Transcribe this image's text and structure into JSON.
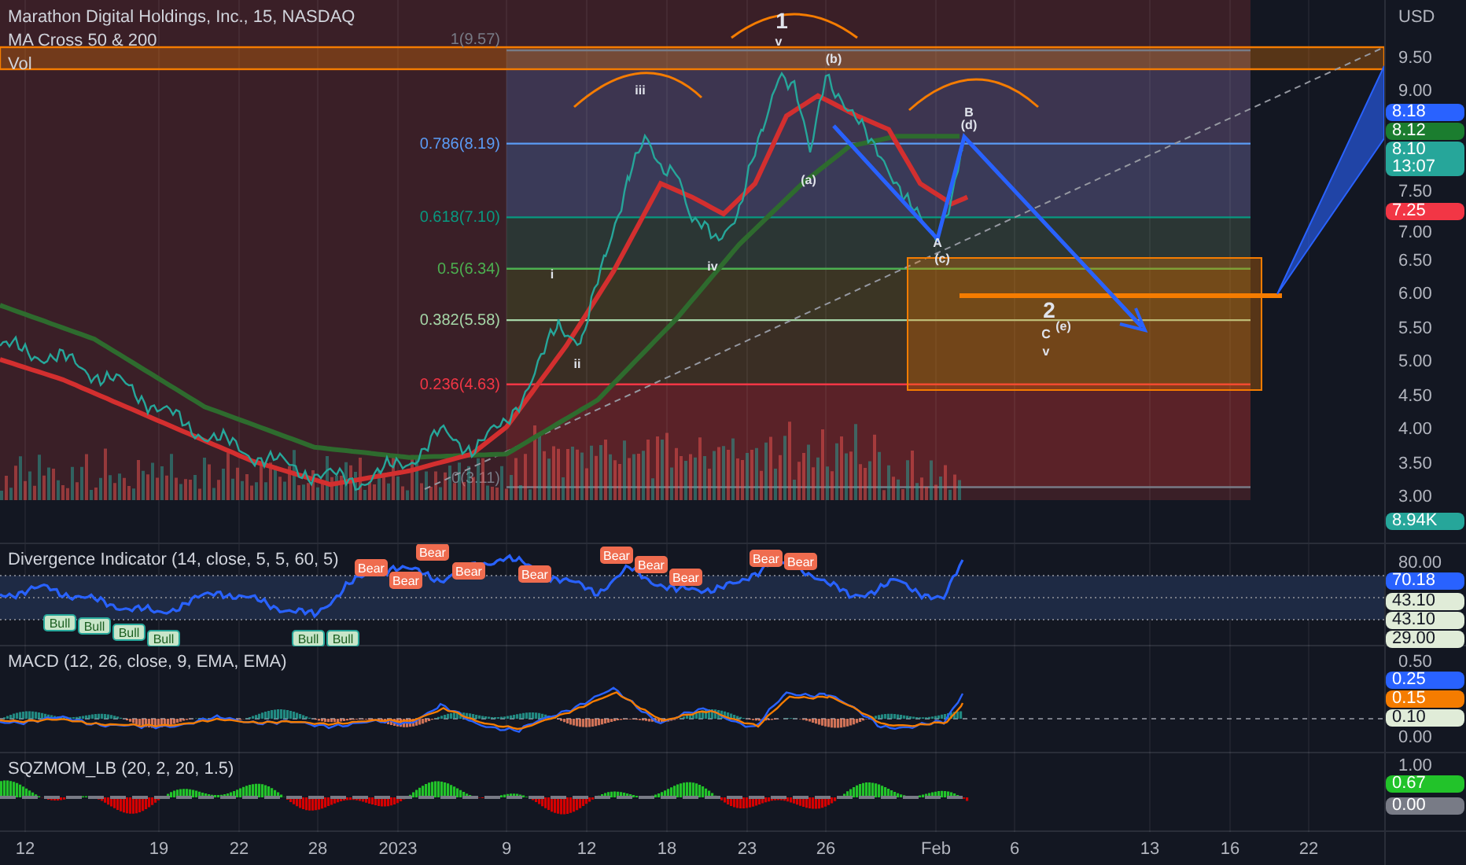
{
  "legend": {
    "symbol": "Marathon Digital Holdings, Inc., 15, NASDAQ",
    "studies": [
      "MA Cross 50 & 200",
      "Vol"
    ]
  },
  "fib_levels": [
    {
      "label": "1(9.57)",
      "color": "#787b86"
    },
    {
      "label": "0.786(8.19)",
      "color": "#5b9cf6"
    },
    {
      "label": "0.618(7.10)",
      "color": "#089981"
    },
    {
      "label": "0.5(6.34)",
      "color": "#4caf50"
    },
    {
      "label": "0.382(5.58)",
      "color": "#a5d6a7"
    },
    {
      "label": "0.236(4.63)",
      "color": "#f23645"
    },
    {
      "label": "0(3.11)",
      "color": "#787b86"
    }
  ],
  "wave_labels": [
    "1",
    "v",
    "iii",
    "(b)",
    "B",
    "(d)",
    "(a)",
    "i",
    "ii",
    "iv",
    "A",
    "(c)",
    "2",
    "(e)",
    "C",
    "v"
  ],
  "price_axis": {
    "unit": "USD",
    "ticks": [
      "9.50",
      "9.00",
      "7.50",
      "7.00",
      "6.50",
      "6.00",
      "5.50",
      "5.00",
      "4.50",
      "4.00",
      "3.50",
      "3.00"
    ],
    "tags": [
      {
        "lines": [
          "8.18"
        ],
        "color": "#2962ff"
      },
      {
        "lines": [
          "8.12"
        ],
        "color": "#1b7d2f"
      },
      {
        "lines": [
          "8.10",
          "13:07"
        ],
        "color": "#26a69a"
      },
      {
        "lines": [
          "7.25"
        ],
        "color": "#f23645"
      }
    ]
  },
  "volume_tag": {
    "lines": [
      "8.94K"
    ],
    "color": "#26a69a"
  },
  "panes": [
    {
      "kind": "divergence",
      "title": "Divergence Indicator (14, close, 5, 5, 60, 5)",
      "ticks": [
        "80.00"
      ],
      "tags": [
        {
          "lines": [
            "70.18"
          ],
          "color": "#2962ff"
        },
        {
          "lines": [
            "43.10"
          ],
          "color": "#e0ecd8"
        },
        {
          "lines": [
            "43.10"
          ],
          "color": "#e0ecd8"
        },
        {
          "lines": [
            "29.00"
          ],
          "color": "#e0ecd8"
        }
      ],
      "markers": [
        {
          "kind": "bull",
          "text": "Bull"
        },
        {
          "kind": "bull",
          "text": "Bull"
        },
        {
          "kind": "bull",
          "text": "Bull"
        },
        {
          "kind": "bull",
          "text": "Bull"
        },
        {
          "kind": "bull",
          "text": "Bull"
        },
        {
          "kind": "bull",
          "text": "Bull"
        },
        {
          "kind": "bear",
          "text": "Bear"
        },
        {
          "kind": "bear",
          "text": "Bear"
        },
        {
          "kind": "bear",
          "text": "Bear"
        },
        {
          "kind": "bear",
          "text": "Bear"
        },
        {
          "kind": "bear",
          "text": "Bear"
        },
        {
          "kind": "bear",
          "text": "Bear"
        },
        {
          "kind": "bear",
          "text": "Bear"
        },
        {
          "kind": "bear",
          "text": "Bear"
        },
        {
          "kind": "bear",
          "text": "Bear"
        },
        {
          "kind": "bear",
          "text": "Bear"
        }
      ]
    },
    {
      "kind": "macd",
      "title": "MACD (12, 26, close, 9, EMA, EMA)",
      "ticks": [
        "0.50",
        "0.00"
      ],
      "tags": [
        {
          "lines": [
            "0.25"
          ],
          "color": "#2962ff"
        },
        {
          "lines": [
            "0.15"
          ],
          "color": "#f57c00"
        },
        {
          "lines": [
            "0.10"
          ],
          "color": "#e0ecd8"
        }
      ]
    },
    {
      "kind": "squeeze",
      "title": "SQZMOM_LB (20, 2, 20, 1.5)",
      "ticks": [
        "1.00"
      ],
      "tags": [
        {
          "lines": [
            "0.67"
          ],
          "color": "#22c32a"
        },
        {
          "lines": [
            "0.00"
          ],
          "color": "#787b86"
        }
      ]
    }
  ],
  "time_axis": [
    "12",
    "19",
    "22",
    "28",
    "2023",
    "9",
    "12",
    "18",
    "23",
    "26",
    "Feb",
    "6",
    "13",
    "16",
    "22"
  ]
}
